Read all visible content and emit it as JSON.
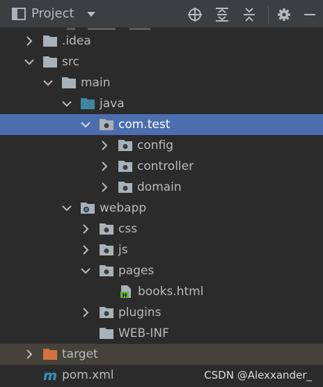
{
  "header": {
    "title": "Project"
  },
  "tree": {
    "idea": ".idea",
    "src": "src",
    "main": "main",
    "java": "java",
    "com_test": "com.test",
    "config": "config",
    "controller": "controller",
    "domain": "domain",
    "webapp": "webapp",
    "css": "css",
    "js": "js",
    "pages": "pages",
    "books": "books.html",
    "plugins": "plugins",
    "web_inf": "WEB-INF",
    "target": "target",
    "pom": "pom.xml"
  },
  "watermark": "CSDN @Alexxander_",
  "colors": {
    "background": "#2b2b2b",
    "header": "#3c3f41",
    "selection": "#4b6eaf",
    "excluded": "#45413b",
    "folder": "#a9b1b9",
    "source_folder": "#3e86a0",
    "target_folder": "#d2733f",
    "maven": "#3592c4"
  }
}
